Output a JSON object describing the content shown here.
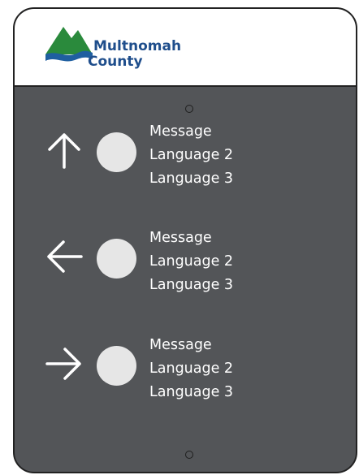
{
  "logo": {
    "name_line_1": "Multnomah",
    "name_line_2": "County",
    "colors": {
      "mountain_green": "#2a8a3c",
      "river_blue": "#1f5fa0",
      "text_blue": "#1f4e8c"
    }
  },
  "colors": {
    "panel": "#535558",
    "text": "#ffffff",
    "marker": "#e6e6e6",
    "border": "#222222"
  },
  "rows": [
    {
      "icon": "arrow-up-icon",
      "lines": [
        "Message",
        "Language 2",
        "Language 3"
      ]
    },
    {
      "icon": "arrow-left-icon",
      "lines": [
        "Message",
        "Language 2",
        "Language 3"
      ]
    },
    {
      "icon": "arrow-right-icon",
      "lines": [
        "Message",
        "Language 2",
        "Language 3"
      ]
    }
  ]
}
